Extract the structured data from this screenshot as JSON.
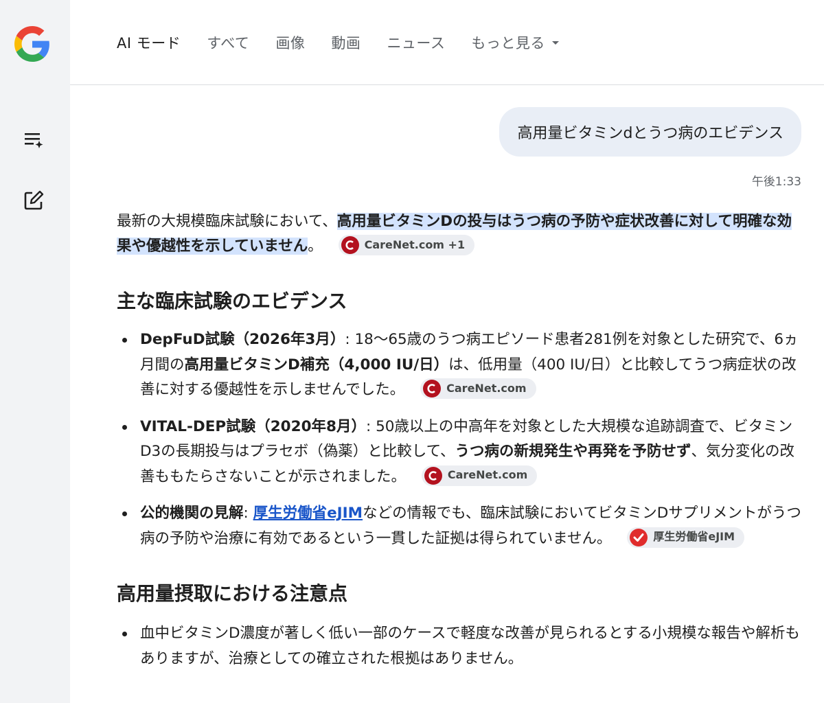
{
  "nav": {
    "tabs": [
      {
        "label": "AI モード",
        "active": true
      },
      {
        "label": "すべて"
      },
      {
        "label": "画像"
      },
      {
        "label": "動画"
      },
      {
        "label": "ニュース"
      },
      {
        "label": "もっと見る"
      }
    ]
  },
  "rail": {
    "icons": [
      "google-logo",
      "history-icon",
      "new-chat-icon"
    ]
  },
  "conversation": {
    "user_query": "高用量ビタミンdとうつ病のエビデンス",
    "timestamp": "午後1:33",
    "intro": {
      "text_before": "最新の大規模臨床試験において、",
      "highlight": "高用量ビタミンDの投与はうつ病の予防や症状改善に対して明確な効果や優越性を示していません",
      "text_after": "。",
      "chip": "CareNet.com +1"
    },
    "section1": {
      "heading": "主な臨床試験のエビデンス",
      "items": [
        {
          "bold": "DepFuD試験（2026年3月）",
          "t1": ": 18〜65歳のうつ病エピソード患者281例を対象とした研究で、6ヵ月間の",
          "bold2": "高用量ビタミンD補充（4,000 IU/日）",
          "t2": "は、低用量（400 IU/日）と比較してうつ病症状の改善に対する優越性を示しませんでした。",
          "chip": "CareNet.com"
        },
        {
          "bold": "VITAL-DEP試験（2020年8月）",
          "t1": ": 50歳以上の中高年を対象とした大規模な追跡調査で、ビタミンD3の長期投与はプラセボ（偽薬）と比較して、",
          "bold2": "うつ病の新規発生や再発を予防せず",
          "t2": "、気分変化の改善ももたらさないことが示されました。",
          "chip": "CareNet.com"
        },
        {
          "bold": "公的機関の見解",
          "t1": ": ",
          "link": "厚生労働省eJIM",
          "t2": "などの情報でも、臨床試験においてビタミンDサプリメントがうつ病の予防や治療に有効であるという一貫した証拠は得られていません。",
          "chip": "厚生労働省eJIM"
        }
      ]
    },
    "section2": {
      "heading": "高用量摂取における注意点",
      "items": [
        {
          "text": "血中ビタミンD濃度が著しく低い一部のケースで軽度な改善が見られるとする小規模な報告や解析もありますが、治療としての確立された根拠はありません。"
        }
      ]
    }
  }
}
